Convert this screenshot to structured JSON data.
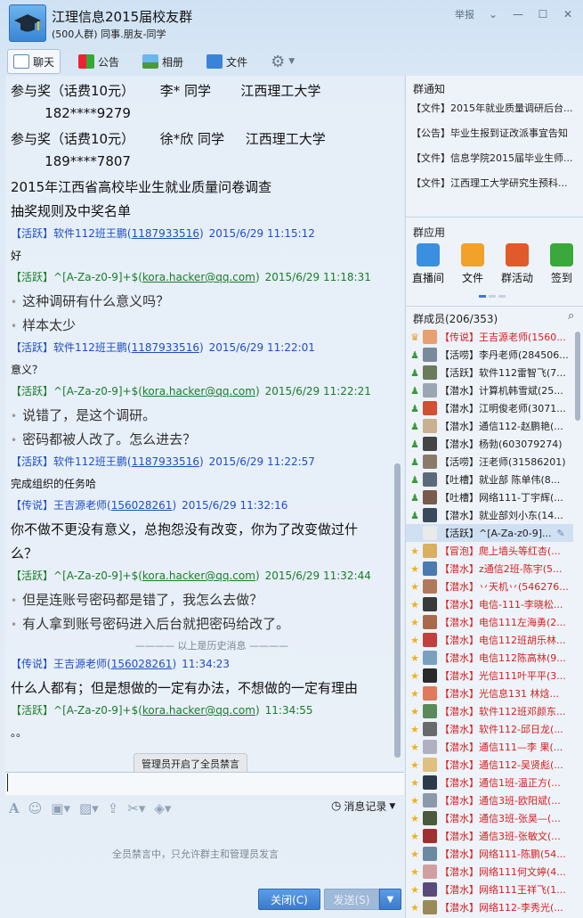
{
  "window": {
    "title": "江理信息2015届校友群",
    "subtitle": "(500人群) 同事.朋友-同学",
    "report_label": "举报"
  },
  "tabs": [
    {
      "label": "聊天",
      "icon": "chat-icon"
    },
    {
      "label": "公告",
      "icon": "flag-icon"
    },
    {
      "label": "相册",
      "icon": "photo-icon"
    },
    {
      "label": "文件",
      "icon": "folder-icon"
    }
  ],
  "chat": {
    "messages": [
      {
        "kind": "big",
        "text": "参与奖（话费10元）      李* 同学       江西理工大学"
      },
      {
        "kind": "big",
        "text": "        182****9279"
      },
      {
        "kind": "big",
        "text": "参与奖（话费10元）      徐*欣 同学     江西理工大学"
      },
      {
        "kind": "big",
        "text": "        189****7807"
      },
      {
        "kind": "big",
        "text": "2015年江西省高校毕业生就业质量问卷调查"
      },
      {
        "kind": "big",
        "text": "抽奖规则及中奖名单"
      },
      {
        "kind": "hdr",
        "color": "b",
        "tag": "【活跃】",
        "name": "软件112班王鹏",
        "qq": "1187933516",
        "time": "2015/6/29 11:15:12"
      },
      {
        "kind": "small",
        "text": "好"
      },
      {
        "kind": "hdr",
        "color": "g",
        "tag": "【活跃】",
        "name": "^[A-Za-z0-9]+$",
        "qq": "kora.hacker@qq.com",
        "time": "2015/6/29 11:18:31"
      },
      {
        "kind": "gray",
        "text": "这种调研有什么意义吗？"
      },
      {
        "kind": "gray",
        "text": "样本太少"
      },
      {
        "kind": "hdr",
        "color": "b",
        "tag": "【活跃】",
        "name": "软件112班王鹏",
        "qq": "1187933516",
        "time": "2015/6/29 11:22:01"
      },
      {
        "kind": "small",
        "text": "意义？"
      },
      {
        "kind": "hdr",
        "color": "g",
        "tag": "【活跃】",
        "name": "^[A-Za-z0-9]+$",
        "qq": "kora.hacker@qq.com",
        "time": "2015/6/29 11:22:21"
      },
      {
        "kind": "gray",
        "text": "说错了，是这个调研。"
      },
      {
        "kind": "gray",
        "text": "密码都被人改了。怎么进去？"
      },
      {
        "kind": "hdr",
        "color": "b",
        "tag": "【活跃】",
        "name": "软件112班王鹏",
        "qq": "1187933516",
        "time": "2015/6/29 11:22:57"
      },
      {
        "kind": "small",
        "text": "完成组织的任务哈"
      },
      {
        "kind": "hdr",
        "color": "b",
        "tag": "【传说】",
        "name": "王吉源老师",
        "qq": "156028261",
        "time": "2015/6/29 11:32:16"
      },
      {
        "kind": "big",
        "text": "你不做不更没有意义，总抱怨没有改变，你为了改变做过什"
      },
      {
        "kind": "big",
        "text": "么？"
      },
      {
        "kind": "hdr",
        "color": "g",
        "tag": "【活跃】",
        "name": "^[A-Za-z0-9]+$",
        "qq": "kora.hacker@qq.com",
        "time": "2015/6/29 11:32:44"
      },
      {
        "kind": "gray",
        "text": "但是连账号密码都是错了，我怎么去做？"
      },
      {
        "kind": "gray",
        "text": "有人拿到账号密码进入后台就把密码给改了。"
      },
      {
        "kind": "divider",
        "text": "———— 以上是历史消息 ————"
      },
      {
        "kind": "hdr",
        "color": "b",
        "tag": "【传说】",
        "name": "王吉源老师",
        "qq": "156028261",
        "time": "11:34:23"
      },
      {
        "kind": "big",
        "text": "什么人都有；但是想做的一定有办法，不想做的一定有理由"
      },
      {
        "kind": "hdr",
        "color": "g",
        "tag": "【活跃】",
        "name": "^[A-Za-z0-9]+$",
        "qq": "kora.hacker@qq.com",
        "time": "11:34:55"
      },
      {
        "kind": "small",
        "text": "。。"
      }
    ],
    "system_notice": "管理员开启了全员禁言"
  },
  "input": {
    "history_label": "消息记录",
    "muted_message": "全员禁言中，只允许群主和管理员发言",
    "close_label": "关闭(C)",
    "send_label": "发送(S)"
  },
  "right": {
    "notice_title": "群通知",
    "notices": [
      "【文件】2015年就业质量调研后台...",
      "【公告】毕业生报到证改派事宜告知",
      "【文件】信息学院2015届毕业生师...",
      "【文件】江西理工大学研究生预科..."
    ],
    "apps_title": "群应用",
    "apps": [
      {
        "label": "直播间",
        "icon": "live-icon",
        "color": "#3a8fe0"
      },
      {
        "label": "文件",
        "icon": "file-icon",
        "color": "#f2a12a"
      },
      {
        "label": "群活动",
        "icon": "activity-icon",
        "color": "#e05a2a"
      },
      {
        "label": "签到",
        "icon": "checkin-icon",
        "color": "#3aa83a"
      }
    ],
    "members_title": "群成员(206/353)",
    "members": [
      {
        "text": "【传说】王吉源老师(1560...",
        "red": true,
        "role": "owner",
        "sel": false
      },
      {
        "text": "【活唠】李丹老师(284506...",
        "red": false,
        "role": "admin",
        "sel": false
      },
      {
        "text": "【活跃】软件112雷智飞(7...",
        "red": false,
        "role": "admin",
        "sel": false
      },
      {
        "text": "【潜水】计算机韩雪斌(25...",
        "red": false,
        "role": "admin",
        "sel": false
      },
      {
        "text": "【潜水】江明俊老师(3071...",
        "red": false,
        "role": "admin",
        "sel": false
      },
      {
        "text": "【潜水】通信112-赵鹏艳(...",
        "red": false,
        "role": "admin",
        "sel": false
      },
      {
        "text": "【潜水】杨勃(603079274)",
        "red": false,
        "role": "admin",
        "sel": false
      },
      {
        "text": "【活唠】汪老师(31586201)",
        "red": false,
        "role": "admin",
        "sel": false
      },
      {
        "text": "【吐槽】就业部 陈单伟(8...",
        "red": false,
        "role": "admin",
        "sel": false
      },
      {
        "text": "【吐槽】网络111-丁宇辉(...",
        "red": false,
        "role": "admin",
        "sel": false
      },
      {
        "text": "【潜水】就业部刘小东(14...",
        "red": false,
        "role": "admin",
        "sel": false
      },
      {
        "text": "【活跃】^[A-Za-z0-9]...",
        "red": false,
        "role": "none",
        "sel": true
      },
      {
        "text": "【冒泡】爬上墙头等红杏(...",
        "red": true,
        "role": "star",
        "sel": false
      },
      {
        "text": "【潜水】z通信2班-陈宇(5...",
        "red": true,
        "role": "star",
        "sel": false
      },
      {
        "text": "【潜水】丷天机丷(546276...",
        "red": true,
        "role": "star",
        "sel": false
      },
      {
        "text": "【潜水】电信-111-李晓松...",
        "red": true,
        "role": "star",
        "sel": false
      },
      {
        "text": "【潜水】电信111左海勇(2...",
        "red": true,
        "role": "star",
        "sel": false
      },
      {
        "text": "【潜水】电信112班胡乐林...",
        "red": true,
        "role": "star",
        "sel": false
      },
      {
        "text": "【潜水】电信112陈高林(9...",
        "red": true,
        "role": "star",
        "sel": false
      },
      {
        "text": "【潜水】光信111叶平平(3...",
        "red": true,
        "role": "star",
        "sel": false
      },
      {
        "text": "【潜水】光信息131 林焓...",
        "red": true,
        "role": "star",
        "sel": false
      },
      {
        "text": "【潜水】软件112班邓颜东...",
        "red": true,
        "role": "star",
        "sel": false
      },
      {
        "text": "【潜水】软件112-邱日龙(...",
        "red": true,
        "role": "star",
        "sel": false
      },
      {
        "text": "【潜水】通信111—李 果(...",
        "red": true,
        "role": "star",
        "sel": false
      },
      {
        "text": "【潜水】通信112-吴贤彪(...",
        "red": true,
        "role": "star",
        "sel": false
      },
      {
        "text": "【潜水】通信1班-温正方(...",
        "red": true,
        "role": "star",
        "sel": false
      },
      {
        "text": "【潜水】通信3班-欧阳斌(...",
        "red": true,
        "role": "star",
        "sel": false
      },
      {
        "text": "【潜水】通信3班-张昊—(...",
        "red": true,
        "role": "star",
        "sel": false
      },
      {
        "text": "【潜水】通信3班-张敏文(...",
        "red": true,
        "role": "star",
        "sel": false
      },
      {
        "text": "【潜水】网络111-陈鹏(54...",
        "red": true,
        "role": "star",
        "sel": false
      },
      {
        "text": "【潜水】网络111何文婷(4...",
        "red": true,
        "role": "star",
        "sel": false
      },
      {
        "text": "【潜水】网络111王祥飞(1...",
        "red": true,
        "role": "star",
        "sel": false
      },
      {
        "text": "【潜水】网络112-李秀光(...",
        "red": true,
        "role": "star",
        "sel": false
      }
    ]
  }
}
